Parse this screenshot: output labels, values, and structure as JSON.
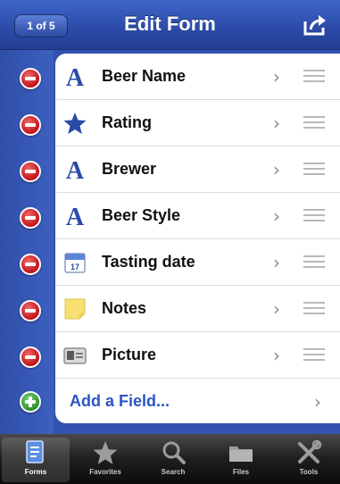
{
  "nav": {
    "pager": "1 of 5",
    "title": "Edit Form"
  },
  "fields": [
    {
      "label": "Beer Name",
      "icon": "text-a-icon"
    },
    {
      "label": "Rating",
      "icon": "star-icon"
    },
    {
      "label": "Brewer",
      "icon": "text-a-icon"
    },
    {
      "label": "Beer Style",
      "icon": "text-a-icon"
    },
    {
      "label": "Tasting date",
      "icon": "calendar-icon"
    },
    {
      "label": "Notes",
      "icon": "notes-icon"
    },
    {
      "label": "Picture",
      "icon": "picture-icon"
    }
  ],
  "add_field": {
    "label": "Add a Field..."
  },
  "tabs": [
    {
      "label": "Forms",
      "icon": "forms-icon",
      "active": true
    },
    {
      "label": "Favorites",
      "icon": "star-icon",
      "active": false
    },
    {
      "label": "Search",
      "icon": "search-icon",
      "active": false
    },
    {
      "label": "Files",
      "icon": "folder-icon",
      "active": false
    },
    {
      "label": "Tools",
      "icon": "tools-icon",
      "active": false
    }
  ],
  "colors": {
    "nav_blue": "#2b4aa6",
    "delete_red": "#c0141a",
    "add_green": "#2b8f2b",
    "link_blue": "#2c55c4"
  }
}
